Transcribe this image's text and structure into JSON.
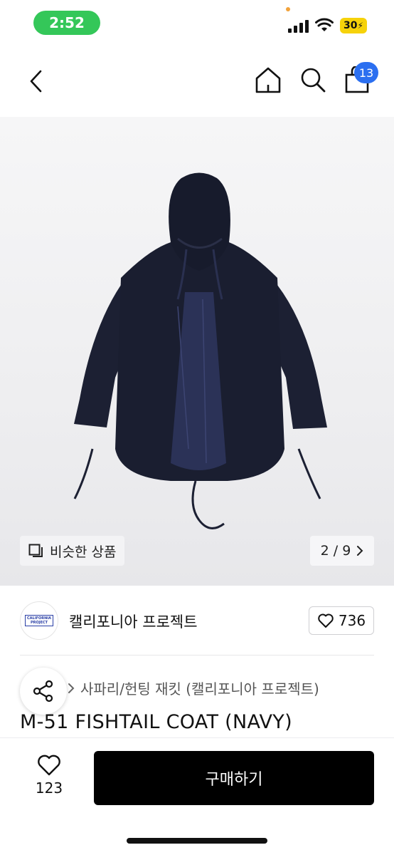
{
  "status_bar": {
    "time": "2:52",
    "battery": "30"
  },
  "nav": {
    "cart_count": "13"
  },
  "colors": {
    "time_pill": "#34c759",
    "battery": "#f6d20a",
    "badge": "#2b6ff0",
    "buy_button": "#000000"
  },
  "icons": [
    "back-chevron-icon",
    "home-icon",
    "search-icon",
    "shopping-bag-icon",
    "similar-items-icon",
    "chevron-right-icon",
    "heart-icon",
    "share-icon"
  ],
  "gallery": {
    "similar_label": "비슷한 상품",
    "pager": "2 / 9"
  },
  "brand": {
    "logo_text": "CALIFORNIA PROJECT",
    "name": "캘리포니아 프로젝트",
    "likes": "736"
  },
  "product": {
    "category": "사파리/헌팅 재킷 (캘리포니아 프로젝트)",
    "title": "M-51 FISHTAIL COAT (NAVY)"
  },
  "bottom": {
    "wish_count": "123",
    "buy_label": "구매하기"
  }
}
